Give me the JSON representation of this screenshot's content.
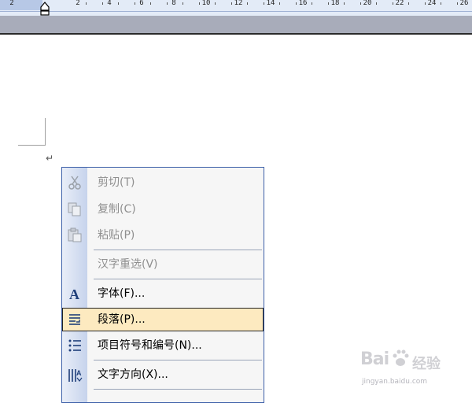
{
  "ruler": {
    "ticks": [
      "2",
      "2",
      "4",
      "6",
      "8",
      "10",
      "12",
      "14",
      "16",
      "18",
      "20",
      "22",
      "24",
      "26"
    ]
  },
  "document": {
    "paragraph_mark": "↵"
  },
  "context_menu": {
    "items": [
      {
        "label": "剪切(T)",
        "icon": "cut-icon",
        "enabled": false
      },
      {
        "label": "复制(C)",
        "icon": "copy-icon",
        "enabled": false
      },
      {
        "label": "粘贴(P)",
        "icon": "paste-icon",
        "enabled": false
      },
      {
        "label": "汉字重选(V)",
        "icon": "",
        "enabled": false
      },
      {
        "label": "字体(F)...",
        "icon": "font-icon",
        "enabled": true
      },
      {
        "label": "段落(P)...",
        "icon": "paragraph-icon",
        "enabled": true,
        "highlighted": true
      },
      {
        "label": "项目符号和编号(N)...",
        "icon": "bullets-numbering-icon",
        "enabled": true
      },
      {
        "label": "文字方向(X)...",
        "icon": "text-direction-icon",
        "enabled": true
      }
    ]
  },
  "watermark": {
    "brand": "Bai",
    "brand2": "经验",
    "url": "jingyan.baidu.com"
  },
  "colors": {
    "menu_border": "#3c5fa8",
    "highlight_bg": "#fdeac0",
    "disabled_text": "#8f8f8f",
    "ruler_bg": "#e3ebf7",
    "band_gray": "#a8acba"
  }
}
